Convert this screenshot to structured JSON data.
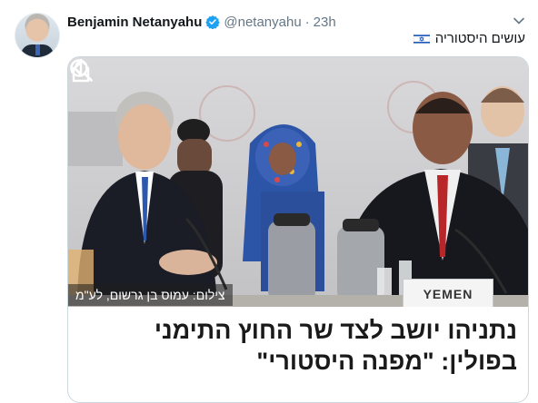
{
  "author": {
    "name": "Benjamin Netanyahu",
    "handle": "@netanyahu",
    "separator": "·",
    "time": "23h"
  },
  "tweet_text": "עושים היסטוריה",
  "card": {
    "photo_credit": "צילום: עמוס בן גרשום, לע\"מ",
    "yemen_sign": "YEMEN",
    "headline_line1": "נתניהו יושב לצד שר החוץ התימני",
    "headline_line2": "בפולין: \"מפנה היסטורי\""
  },
  "icons": {
    "verified": "verified-badge-icon",
    "menu": "chevron-down-icon",
    "flag": "israel-flag-icon",
    "back": "back-arrow-icon",
    "search": "search-icon",
    "share": "share-icon"
  },
  "colors": {
    "verified_blue": "#1da1f2",
    "muted_text": "#657786",
    "border": "#ccd6dd"
  }
}
